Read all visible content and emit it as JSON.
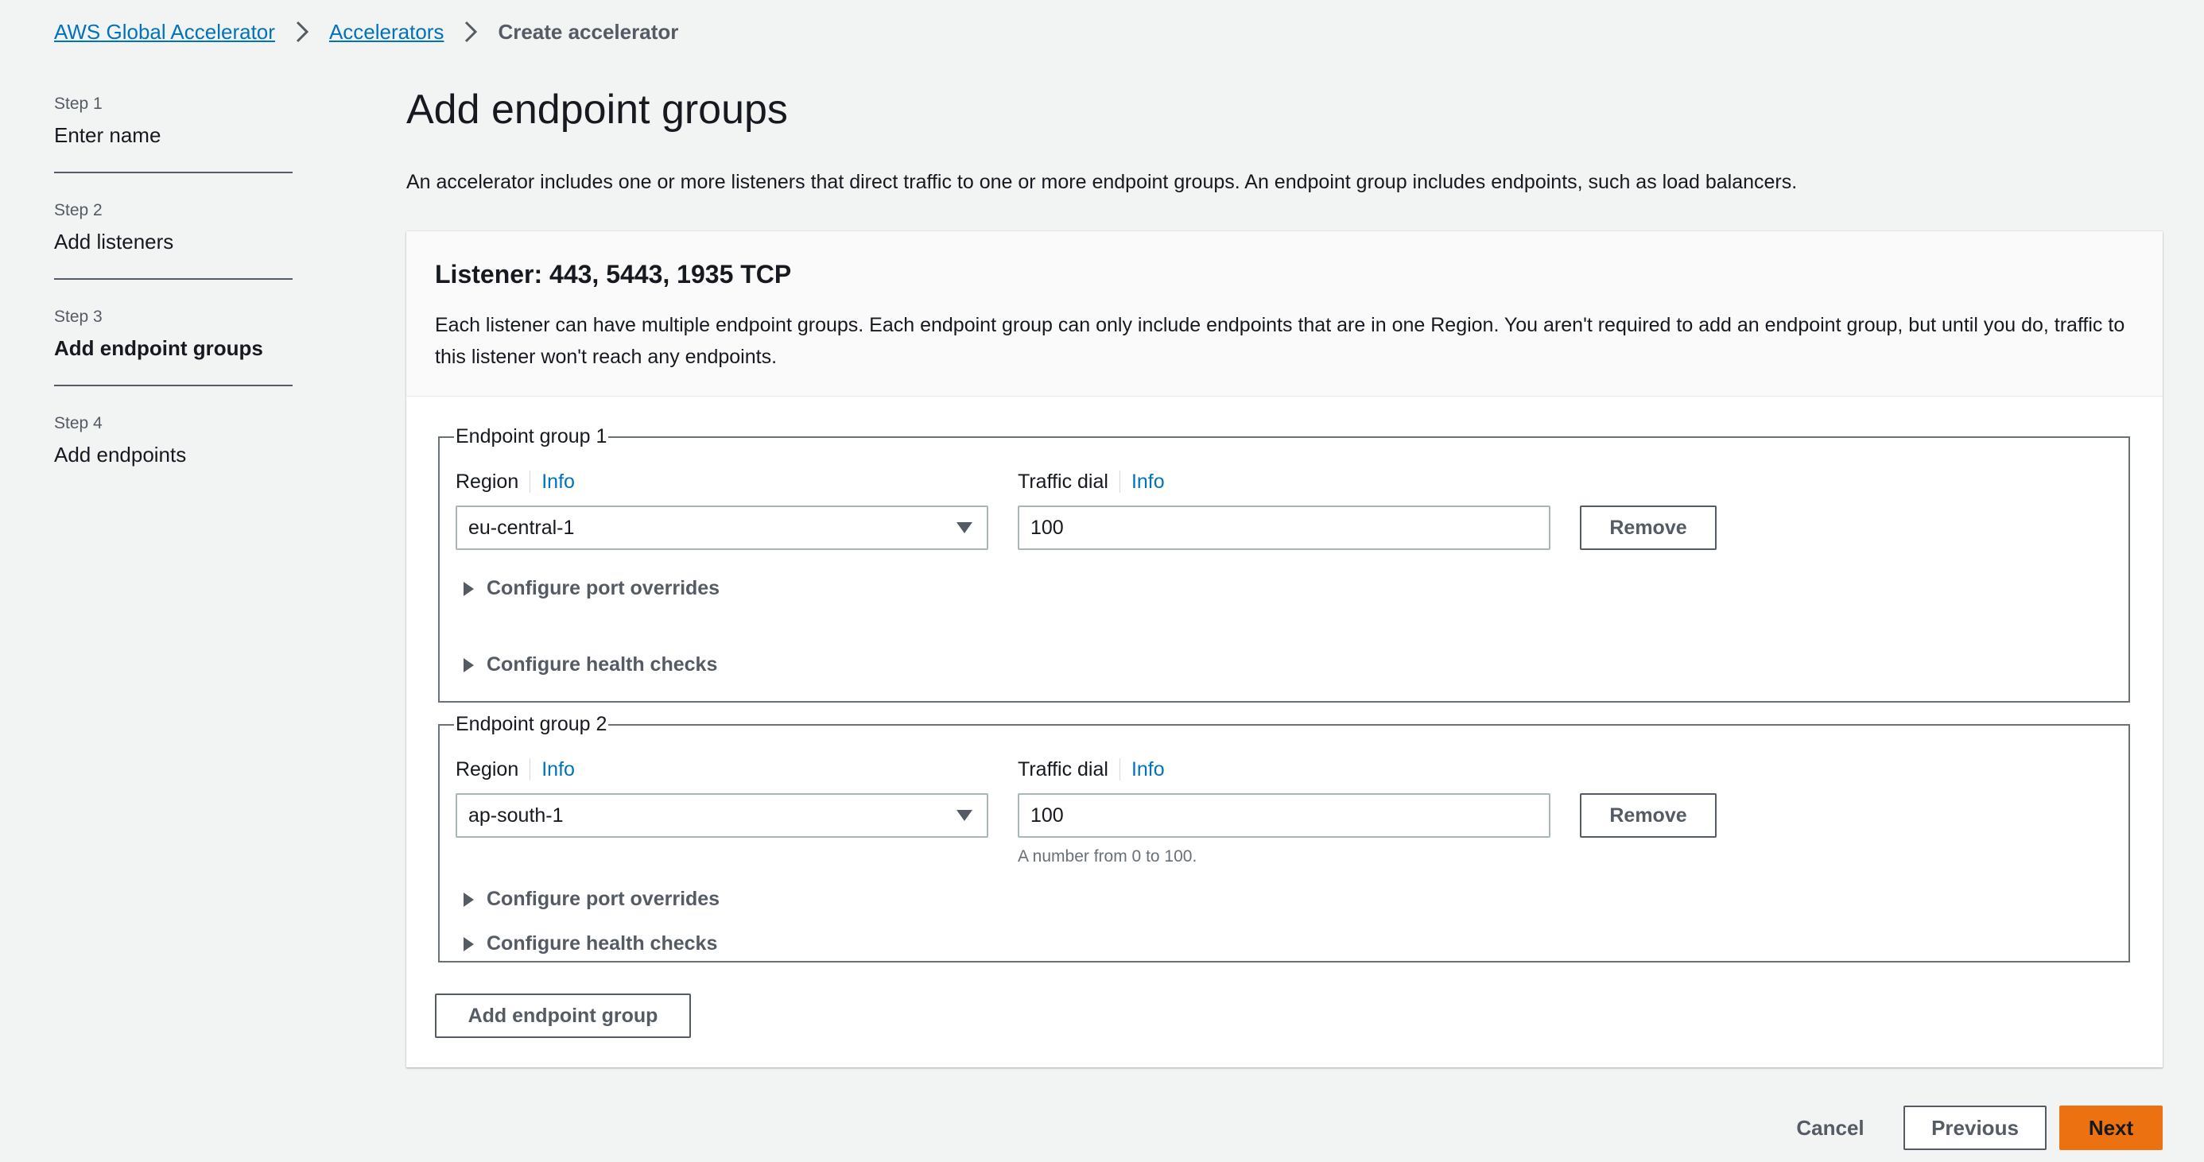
{
  "breadcrumb": {
    "items": [
      "AWS Global Accelerator",
      "Accelerators"
    ],
    "current": "Create accelerator"
  },
  "steps": [
    {
      "num": "Step 1",
      "title": "Enter name"
    },
    {
      "num": "Step 2",
      "title": "Add listeners"
    },
    {
      "num": "Step 3",
      "title": "Add endpoint groups",
      "active": true
    },
    {
      "num": "Step 4",
      "title": "Add endpoints"
    }
  ],
  "page": {
    "title": "Add endpoint groups",
    "description": "An accelerator includes one or more listeners that direct traffic to one or more endpoint groups. An endpoint group includes endpoints, such as load balancers."
  },
  "listener": {
    "title": "Listener: 443, 5443, 1935 TCP",
    "description": "Each listener can have multiple endpoint groups. Each endpoint group can only include endpoints that are in one Region. You aren't required to add an endpoint group, but until you do, traffic to this listener won't reach any endpoints."
  },
  "groups": [
    {
      "legend": "Endpoint group 1",
      "region_label": "Region",
      "region_info": "Info",
      "region_value": "eu-central-1",
      "dial_label": "Traffic dial",
      "dial_info": "Info",
      "dial_value": "100",
      "remove_label": "Remove",
      "port_overrides": "Configure port overrides",
      "health_checks": "Configure health checks"
    },
    {
      "legend": "Endpoint group 2",
      "region_label": "Region",
      "region_info": "Info",
      "region_value": "ap-south-1",
      "dial_label": "Traffic dial",
      "dial_info": "Info",
      "dial_value": "100",
      "dial_hint": "A number from 0 to 100.",
      "remove_label": "Remove",
      "port_overrides": "Configure port overrides",
      "health_checks": "Configure health checks"
    }
  ],
  "add_group_label": "Add endpoint group",
  "footer": {
    "cancel": "Cancel",
    "previous": "Previous",
    "next": "Next"
  },
  "colors": {
    "link": "#0073bb",
    "primary": "#ec7211",
    "background": "#f2f3f3"
  }
}
